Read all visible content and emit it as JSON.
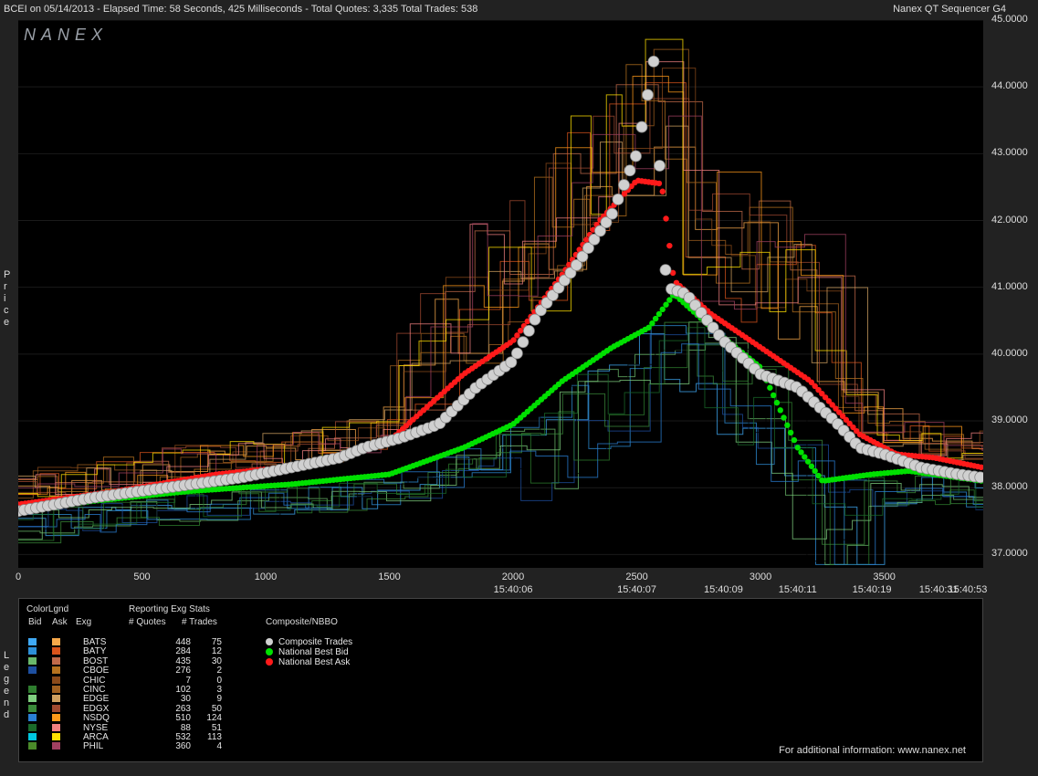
{
  "header": {
    "left": "BCEI on 05/14/2013  -  Elapsed Time: 58 Seconds, 425 Milliseconds  -  Total Quotes: 3,335  Total Trades: 538",
    "right": "Nanex QT Sequencer G4"
  },
  "watermark": "NANEX",
  "ylabel": "Price",
  "legend_side": "Legend",
  "colors": {
    "bid_ask_line_orange": "#e07a1f",
    "bid_line_green": "#4aa04a",
    "nbb": "#00e000",
    "nba": "#ff1a1a",
    "trade": "#d0d0d0"
  },
  "legend": {
    "headers": {
      "color_legend": "ColorLgnd",
      "bid": "Bid",
      "ask": "Ask",
      "exg": "Exg",
      "reporting": "Reporting Exg Stats",
      "quotes": "# Quotes",
      "trades": "# Trades",
      "composite": "Composite/NBBO"
    },
    "rows": [
      {
        "exg": "BATS",
        "quotes": "448",
        "trades": "75",
        "bid": "#3fa9f5",
        "ask": "#f7a84a"
      },
      {
        "exg": "BATY",
        "quotes": "284",
        "trades": "12",
        "bid": "#2d8fd8",
        "ask": "#d9541c"
      },
      {
        "exg": "BOST",
        "quotes": "435",
        "trades": "30",
        "bid": "#6ab86a",
        "ask": "#c06a4a"
      },
      {
        "exg": "CBOE",
        "quotes": "276",
        "trades": "2",
        "bid": "#1d4fa0",
        "ask": "#b5721f"
      },
      {
        "exg": "CHIC",
        "quotes": "7",
        "trades": "0",
        "bid": "#000000",
        "ask": "#8a4a1a"
      },
      {
        "exg": "CINC",
        "quotes": "102",
        "trades": "3",
        "bid": "#2e7d2e",
        "ask": "#a06020"
      },
      {
        "exg": "EDGE",
        "quotes": "30",
        "trades": "9",
        "bid": "#7fcf7f",
        "ask": "#cfa060"
      },
      {
        "exg": "EDGX",
        "quotes": "263",
        "trades": "50",
        "bid": "#3a8a3a",
        "ask": "#a04a30"
      },
      {
        "exg": "NSDQ",
        "quotes": "510",
        "trades": "124",
        "bid": "#2a7fd4",
        "ask": "#ff9a1a"
      },
      {
        "exg": "NYSE",
        "quotes": "88",
        "trades": "51",
        "bid": "#1a6a2a",
        "ask": "#f08080"
      },
      {
        "exg": "ARCA",
        "quotes": "532",
        "trades": "113",
        "bid": "#00c8e0",
        "ask": "#ffe000"
      },
      {
        "exg": "PHIL",
        "quotes": "360",
        "trades": "4",
        "bid": "#4a8a2a",
        "ask": "#a04060"
      }
    ],
    "composite": [
      "Composite Trades",
      "National Best Bid",
      "National Best Ask"
    ]
  },
  "footer": "For additional information: www.nanex.net",
  "chart_data": {
    "type": "line",
    "title": "BCEI on 05/14/2013",
    "xlabel": "",
    "ylabel": "Price",
    "xlim": [
      0,
      3900
    ],
    "ylim": [
      36.8,
      45.0
    ],
    "x_ticks": [
      0,
      500,
      1000,
      1500,
      2000,
      2500,
      3000,
      3500
    ],
    "y_ticks": [
      "45.0000",
      "44.0000",
      "43.0000",
      "42.0000",
      "41.0000",
      "40.0000",
      "39.0000",
      "38.0000",
      "37.0000"
    ],
    "time_labels": [
      {
        "x": 2000,
        "label": "15:40:06"
      },
      {
        "x": 2500,
        "label": "15:40:07"
      },
      {
        "x": 2850,
        "label": "15:40:09"
      },
      {
        "x": 3150,
        "label": "15:40:11"
      },
      {
        "x": 3450,
        "label": "15:40:19"
      },
      {
        "x": 3720,
        "label": "15:40:31"
      },
      {
        "x": 3900,
        "label": "15:40:53"
      }
    ],
    "series": [
      {
        "name": "Composite Trades",
        "values": [
          [
            0,
            37.65
          ],
          [
            150,
            37.75
          ],
          [
            300,
            37.85
          ],
          [
            500,
            37.95
          ],
          [
            700,
            38.05
          ],
          [
            900,
            38.15
          ],
          [
            1100,
            38.3
          ],
          [
            1300,
            38.45
          ],
          [
            1400,
            38.6
          ],
          [
            1550,
            38.75
          ],
          [
            1700,
            38.95
          ],
          [
            1850,
            39.5
          ],
          [
            2000,
            39.9
          ],
          [
            2100,
            40.6
          ],
          [
            2250,
            41.3
          ],
          [
            2400,
            42.1
          ],
          [
            2500,
            43.0
          ],
          [
            2550,
            44.0
          ],
          [
            2560,
            44.9
          ],
          [
            2620,
            41.0
          ],
          [
            2700,
            40.9
          ],
          [
            2850,
            40.2
          ],
          [
            3000,
            39.7
          ],
          [
            3150,
            39.5
          ],
          [
            3300,
            39.0
          ],
          [
            3400,
            38.6
          ],
          [
            3500,
            38.5
          ],
          [
            3650,
            38.3
          ],
          [
            3800,
            38.2
          ],
          [
            3900,
            38.15
          ]
        ]
      },
      {
        "name": "National Best Bid",
        "values": [
          [
            0,
            37.65
          ],
          [
            300,
            37.8
          ],
          [
            700,
            37.95
          ],
          [
            1100,
            38.05
          ],
          [
            1500,
            38.2
          ],
          [
            1800,
            38.6
          ],
          [
            2000,
            38.95
          ],
          [
            2200,
            39.6
          ],
          [
            2400,
            40.1
          ],
          [
            2550,
            40.4
          ],
          [
            2650,
            40.9
          ],
          [
            2800,
            40.4
          ],
          [
            3000,
            39.8
          ],
          [
            3150,
            38.6
          ],
          [
            3250,
            38.1
          ],
          [
            3450,
            38.2
          ],
          [
            3600,
            38.25
          ],
          [
            3800,
            38.15
          ],
          [
            3900,
            38.1
          ]
        ]
      },
      {
        "name": "National Best Ask",
        "values": [
          [
            0,
            37.75
          ],
          [
            400,
            37.95
          ],
          [
            800,
            38.2
          ],
          [
            1200,
            38.35
          ],
          [
            1500,
            38.7
          ],
          [
            1800,
            39.7
          ],
          [
            2000,
            40.2
          ],
          [
            2200,
            41.2
          ],
          [
            2350,
            42.0
          ],
          [
            2500,
            42.6
          ],
          [
            2600,
            42.55
          ],
          [
            2650,
            41.1
          ],
          [
            2800,
            40.6
          ],
          [
            3000,
            40.1
          ],
          [
            3200,
            39.6
          ],
          [
            3400,
            38.8
          ],
          [
            3550,
            38.5
          ],
          [
            3700,
            38.45
          ],
          [
            3900,
            38.3
          ]
        ]
      }
    ]
  }
}
